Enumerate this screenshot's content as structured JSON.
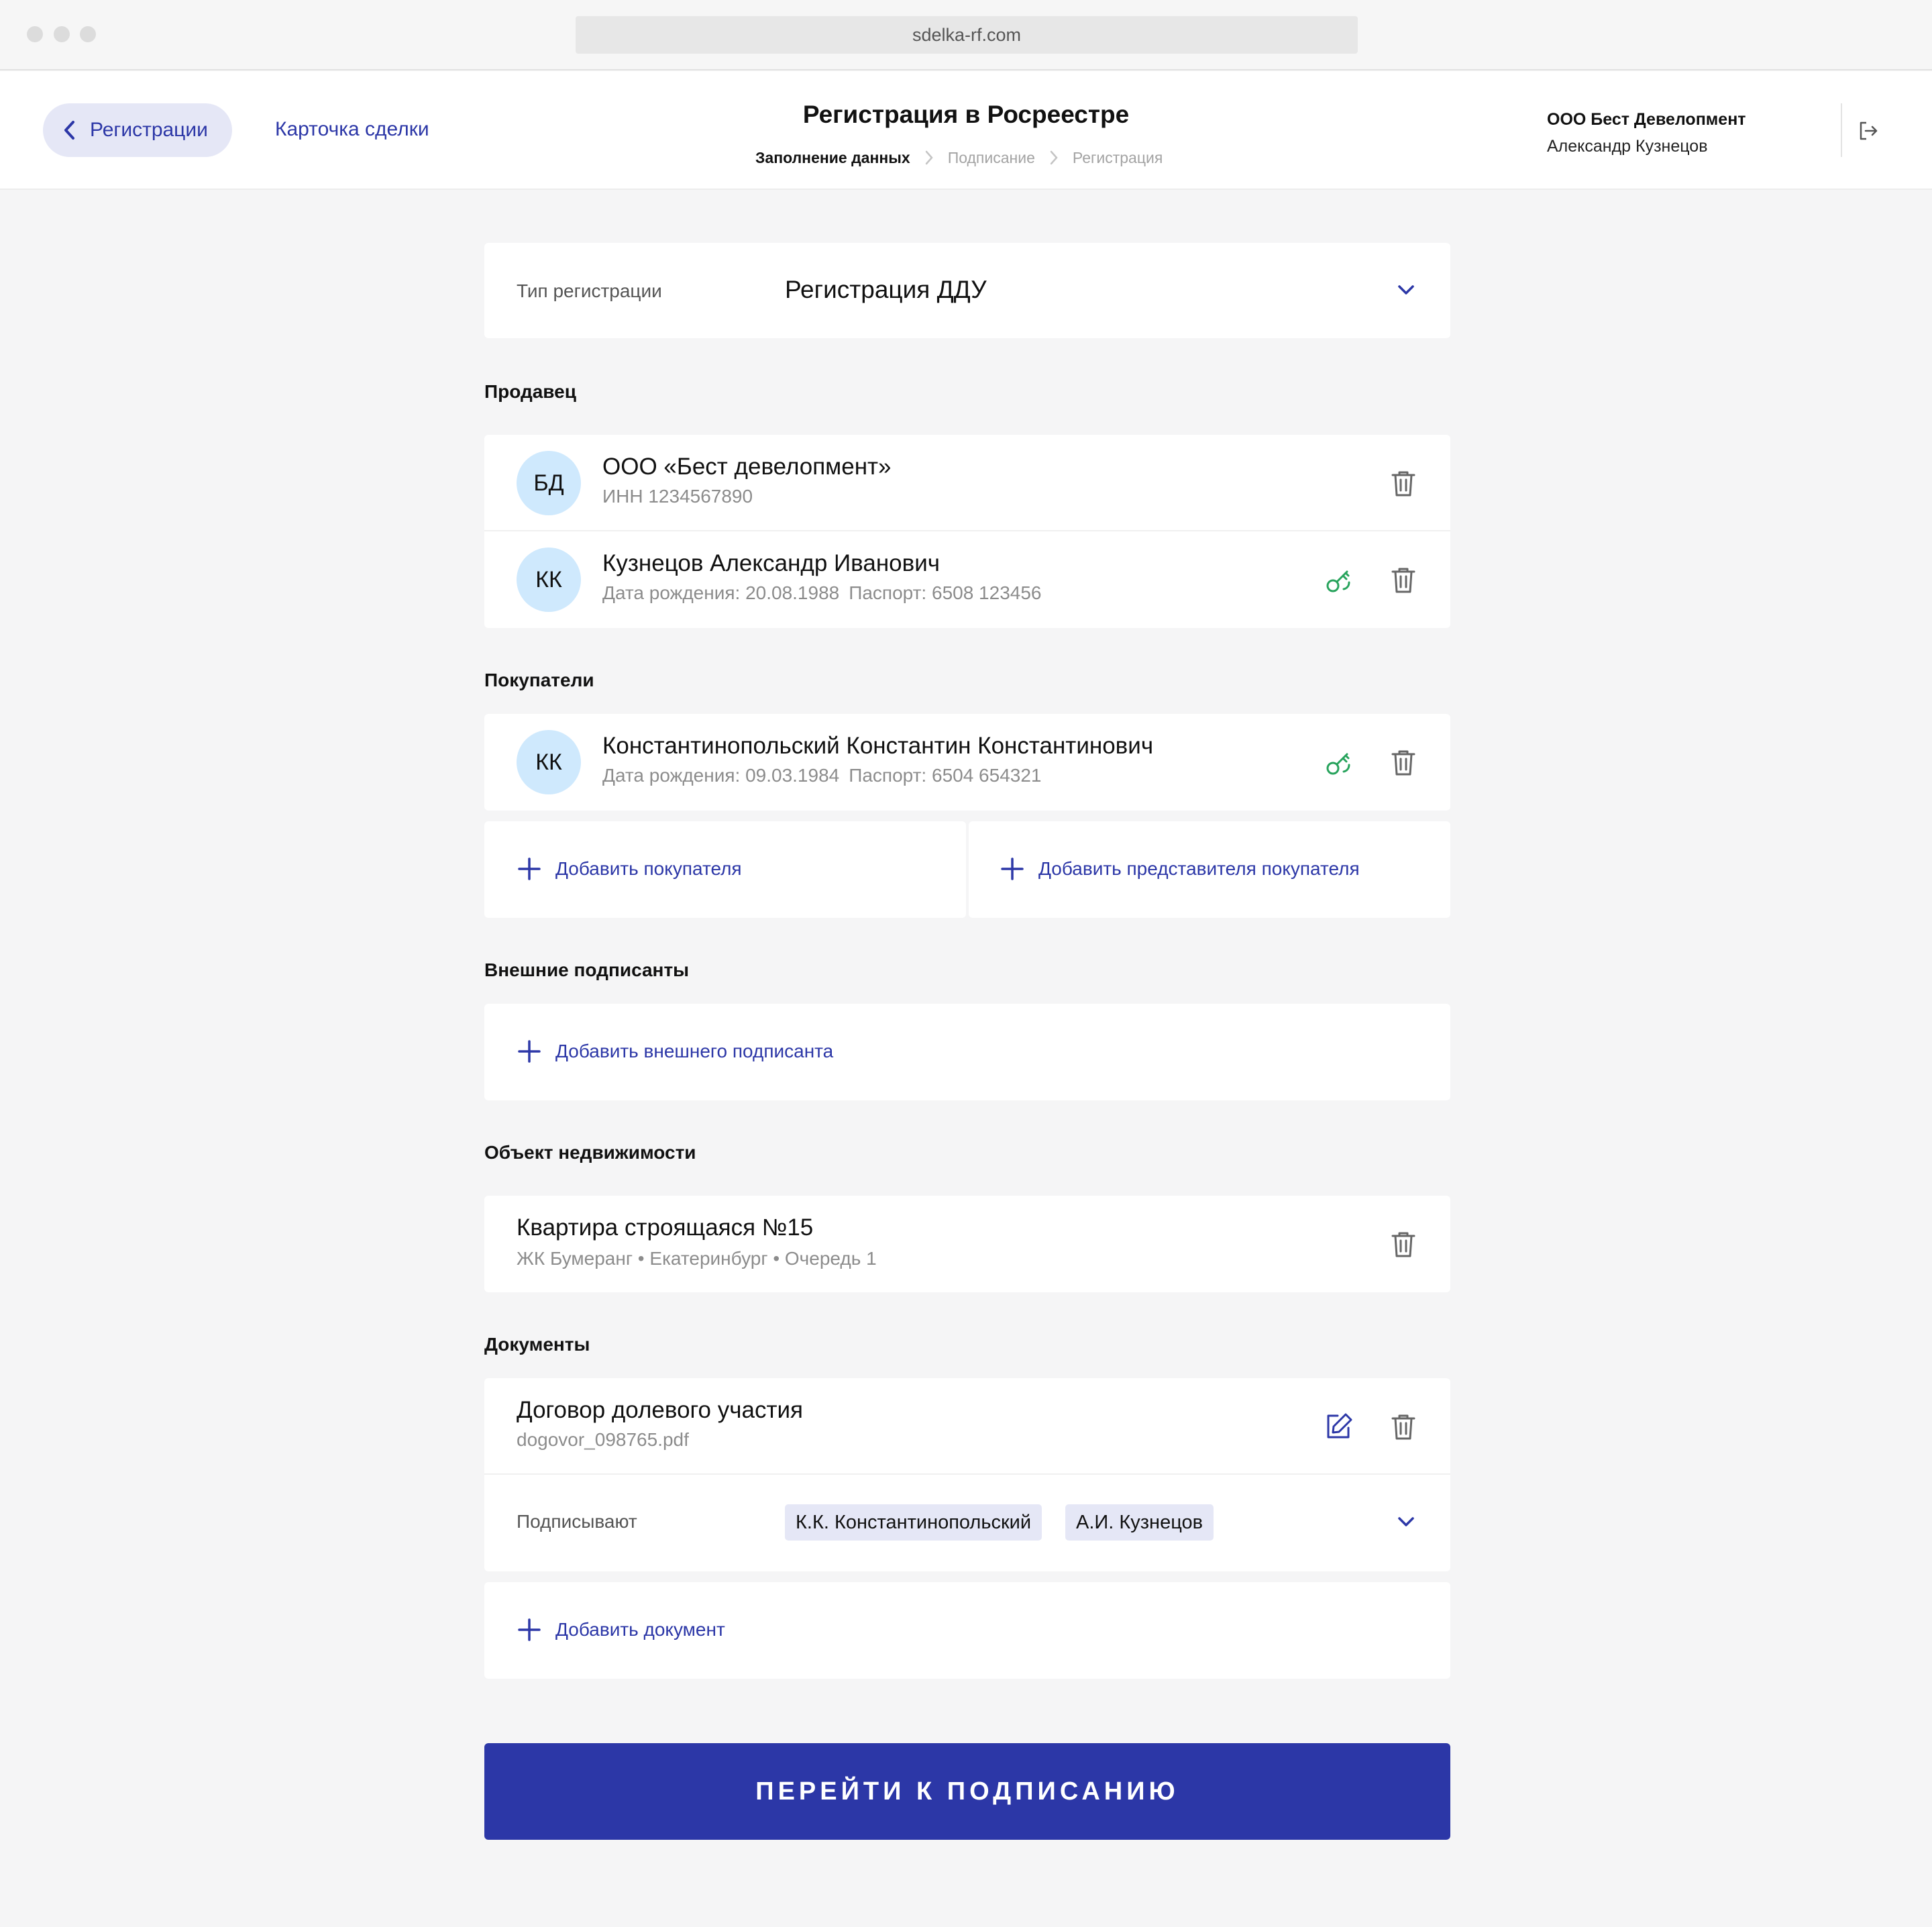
{
  "browser": {
    "url": "sdelka-rf.com"
  },
  "header": {
    "back_label": "Регистрации",
    "deal_link": "Карточка сделки",
    "title": "Регистрация в Росреестре",
    "steps": [
      "Заполнение данных",
      "Подписание",
      "Регистрация"
    ],
    "active_step": 0,
    "org": "ООО Бест Девелопмент",
    "user": "Александр Кузнецов"
  },
  "registration_type": {
    "label": "Тип регистрации",
    "value": "Регистрация ДДУ"
  },
  "seller": {
    "title": "Продавец",
    "items": [
      {
        "initials": "БД",
        "name": "ООО «Бест девелопмент»",
        "sub": "ИНН 1234567890"
      },
      {
        "initials": "КК",
        "name": "Кузнецов Александр Иванович",
        "birth": "Дата рождения: 20.08.1988",
        "passport": "Паспорт: 6508 123456"
      }
    ]
  },
  "buyers": {
    "title": "Покупатели",
    "items": [
      {
        "initials": "КК",
        "name": "Константинопольский Константин Константинович",
        "birth": "Дата рождения: 09.03.1984",
        "passport": "Паспорт: 6504 654321"
      }
    ],
    "add_buyer": "Добавить покупателя",
    "add_representative": "Добавить представителя покупателя"
  },
  "external_signers": {
    "title": "Внешние подписанты",
    "add": "Добавить внешнего подписанта"
  },
  "property": {
    "title": "Объект недвижимости",
    "name": "Квартира строящаяся №15",
    "details": "ЖК Бумеранг • Екатеринбург • Очередь 1"
  },
  "documents": {
    "title": "Документы",
    "items": [
      {
        "name": "Договор долевого участия",
        "file": "dogovor_098765.pdf",
        "signers_label": "Подписывают",
        "signers": [
          "К.К. Константинопольский",
          "А.И. Кузнецов"
        ]
      }
    ],
    "add": "Добавить документ"
  },
  "cta": "ПЕРЕЙТИ К ПОДПИСАНИЮ",
  "colors": {
    "accent": "#2c37a7",
    "accent_light": "#e5e7f6",
    "avatar_bg": "#cfe9fd",
    "success": "#27a35c",
    "background": "#f5f5f6"
  },
  "icons": [
    "chevron-left-icon",
    "chevron-right-icon",
    "logout-icon",
    "chevron-down-icon",
    "trash-icon",
    "key-icon",
    "edit-icon",
    "plus-icon"
  ]
}
